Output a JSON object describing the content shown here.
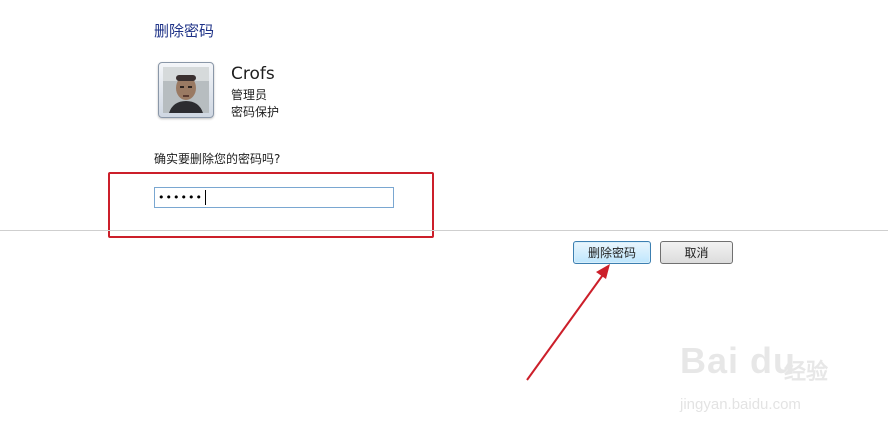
{
  "dialog": {
    "title": "删除密码",
    "question": "确实要删除您的密码吗?"
  },
  "user": {
    "name": "Crofs",
    "role": "管理员",
    "status": "密码保护"
  },
  "password_field": {
    "value": "••••••"
  },
  "buttons": {
    "delete_label": "删除密码",
    "cancel_label": "取消"
  },
  "watermark": {
    "brand": "Bai du",
    "service": "经验",
    "url": "jingyan.baidu.com"
  },
  "colors": {
    "title": "#1e3287",
    "annotation": "#cc1f2a",
    "primary_button_border": "#3c7fb1",
    "field_border": "#7aa7d1"
  }
}
